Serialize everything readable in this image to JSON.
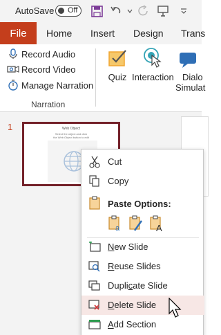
{
  "titlebar": {
    "autosave_label": "AutoSave",
    "autosave_state": "Off"
  },
  "tabs": {
    "file": "File",
    "items": [
      "Home",
      "Insert",
      "Design",
      "Trans"
    ]
  },
  "ribbon": {
    "narration": {
      "record_audio": "Record Audio",
      "record_video": "Record Video",
      "manage_narration": "Manage Narration",
      "group_label": "Narration"
    },
    "quiz": "Quiz",
    "interaction": "Interaction",
    "dialog_1": "Dialo",
    "dialog_2": "Simulat"
  },
  "slide_pane": {
    "slide_number": "1",
    "thumb_title": "Web Object",
    "thumb_sub_1": "Select the object and click",
    "thumb_sub_2": "the Web Object button to edit"
  },
  "context_menu": {
    "cut": "Cut",
    "copy": "Copy",
    "paste_options": "Paste Options:",
    "new_slide": "New Slide",
    "reuse_slides": "Reuse Slides",
    "duplicate_slide": "Duplicate Slide",
    "delete_slide": "Delete Slide",
    "add_section": "Add Section"
  },
  "colors": {
    "accent": "#c43e1c",
    "thumb_border": "#74222a",
    "icon_blue": "#2f6fb6",
    "quiz_orange": "#f0a531",
    "interaction_teal": "#35a4b6",
    "hover": "#f7e7e5"
  }
}
